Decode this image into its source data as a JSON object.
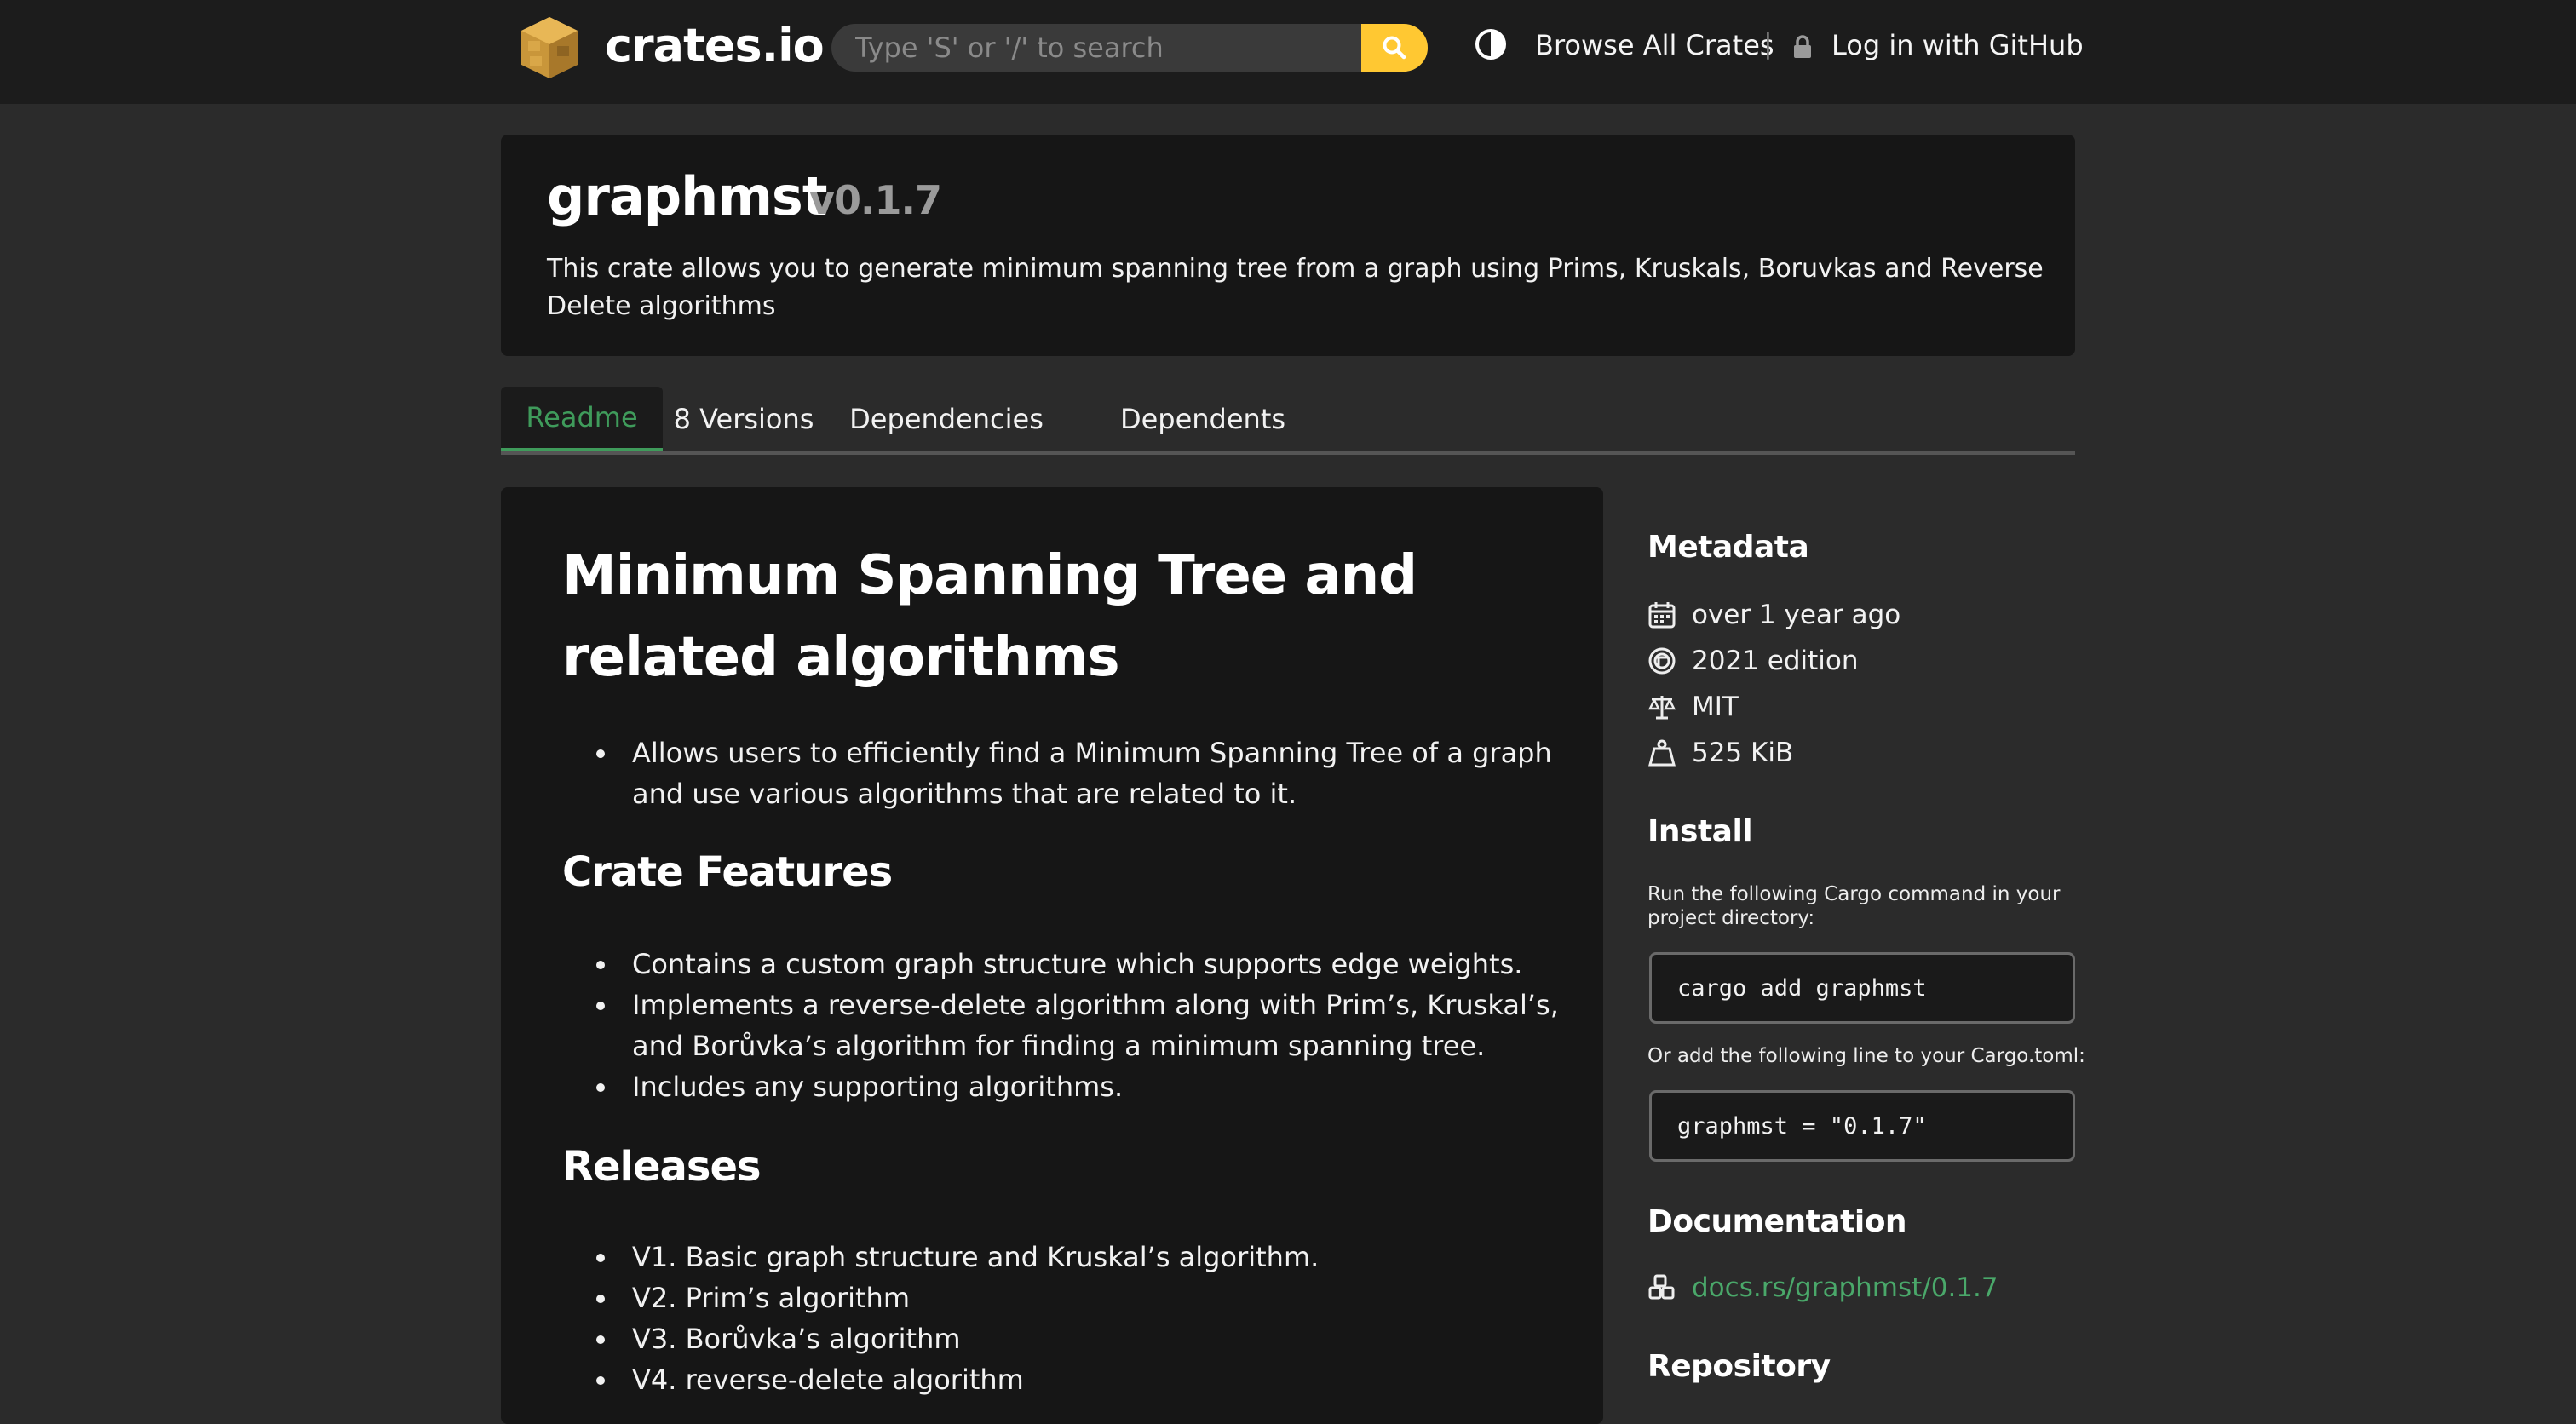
{
  "header": {
    "brand": "crates.io",
    "search_placeholder": "Type 'S' or '/' to search",
    "browse_label": "Browse All Crates",
    "separator": "|",
    "login_label": "Log in with GitHub"
  },
  "crate": {
    "name": "graphmst",
    "version": "v0.1.7",
    "description": "This crate allows you to generate minimum spanning tree from a graph using Prims, Kruskals, Boruvkas and Reverse Delete algorithms"
  },
  "tabs": [
    {
      "label": "Readme",
      "active": true
    },
    {
      "label": "8 Versions",
      "active": false
    },
    {
      "label": "Dependencies",
      "active": false
    },
    {
      "label": "Dependents",
      "active": false
    }
  ],
  "readme": {
    "title": "Minimum Spanning Tree and related algorithms",
    "intro_items": [
      "Allows users to efficiently find a Minimum Spanning Tree of a graph and use various algorithms that are related to it."
    ],
    "features_heading": "Crate Features",
    "features": [
      "Contains a custom graph structure which supports edge weights.",
      "Implements a reverse-delete algorithm along with Prim’s, Kruskal’s, and Borůvka’s algorithm for finding a minimum spanning tree.",
      "Includes any supporting algorithms."
    ],
    "releases_heading": "Releases",
    "releases": [
      "V1. Basic graph structure and Kruskal’s algorithm.",
      "V2. Prim’s algorithm",
      "V3. Borůvka’s algorithm",
      "V4. reverse-delete algorithm"
    ]
  },
  "sidebar": {
    "metadata_heading": "Metadata",
    "metadata": [
      {
        "icon": "calendar-icon",
        "text": "over 1 year ago"
      },
      {
        "icon": "rust-edition-icon",
        "text": "2021 edition"
      },
      {
        "icon": "scale-icon",
        "text": "MIT"
      },
      {
        "icon": "weight-icon",
        "text": "525 KiB"
      }
    ],
    "install_heading": "Install",
    "install_note": "Run the following Cargo command in your project directory:",
    "install_command": "cargo add graphmst",
    "toml_note": "Or add the following line to your Cargo.toml:",
    "toml_line": "graphmst = \"0.1.7\"",
    "documentation_heading": "Documentation",
    "documentation_link": "docs.rs/graphmst/0.1.7",
    "repository_heading": "Repository"
  },
  "colors": {
    "accent_green": "#3f9b5b",
    "search_button": "#ffc832",
    "background": "#2b2b2b",
    "card": "#161616"
  }
}
